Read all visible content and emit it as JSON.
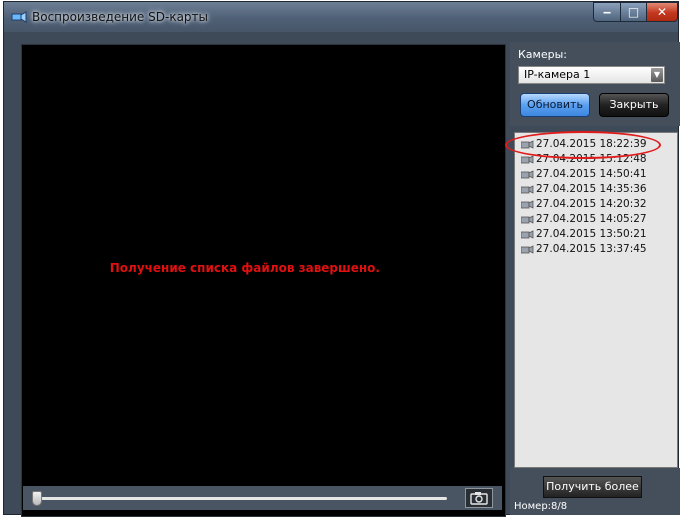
{
  "window": {
    "title": "Воспроизведение SD-карты",
    "minimize_label": "‒",
    "maximize_label": "□",
    "close_label": "✕"
  },
  "video": {
    "message": "Получение списка файлов завершено.",
    "message_color": "#e01010",
    "seek_position": 0.0
  },
  "panel": {
    "cameras_label": "Камеры:",
    "camera_selected": "IP-камера 1",
    "refresh_label": "Обновить",
    "close_label": "Закрыть"
  },
  "files": {
    "items": [
      "27.04.2015 18:22:39",
      "27.04.2015 15:12:48",
      "27.04.2015 14:50:41",
      "27.04.2015 14:35:36",
      "27.04.2015 14:20:32",
      "27.04.2015 14:05:27",
      "27.04.2015 13:50:21",
      "27.04.2015 13:37:45"
    ],
    "highlighted_index": 0,
    "highlight_color": "#e11a1a"
  },
  "footer": {
    "more_label": "Получить более",
    "counter": "Номер:8/8"
  }
}
